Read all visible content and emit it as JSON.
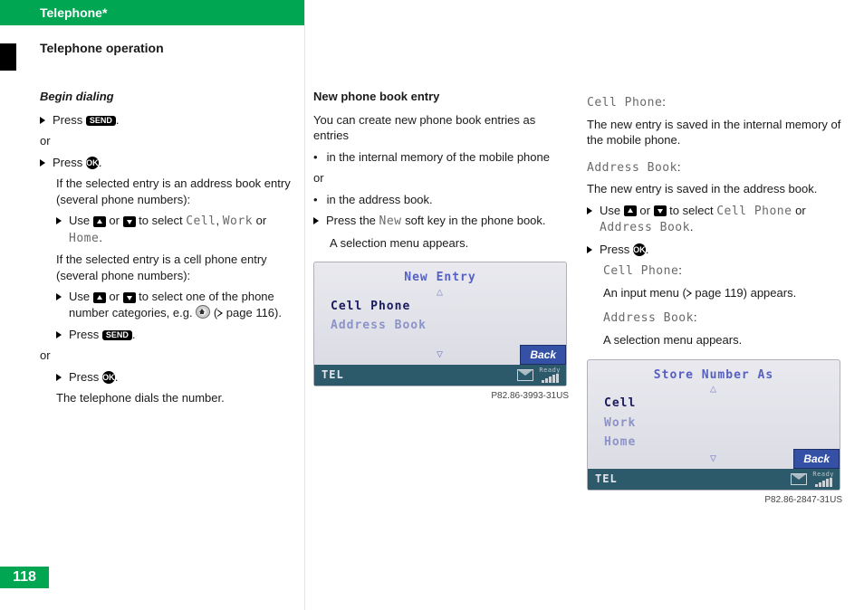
{
  "header": {
    "title": "Telephone*",
    "section": "Telephone operation"
  },
  "page_number": "118",
  "buttons": {
    "send": "SEND",
    "ok": "OK",
    "back": "Back"
  },
  "mono": {
    "cell": "Cell",
    "work": "Work",
    "home": "Home",
    "cell_phone": "Cell Phone",
    "address_book": "Address Book",
    "new": "New"
  },
  "col1": {
    "heading": "Begin dialing",
    "s1_a": "Press ",
    "s1_b": ".",
    "or": "or",
    "s2_a": "Press ",
    "s2_b": ".",
    "p1": "If the selected entry is an address book entry (several phone numbers):",
    "s3_a": "Use ",
    "s3_b": " or ",
    "s3_c": " to select ",
    "s3_d": ", ",
    "s3_e": " or ",
    "s3_f": ".",
    "p2": "If the selected entry is a cell phone entry (several phone numbers):",
    "s4_a": "Use ",
    "s4_b": " or ",
    "s4_c": " to select one of the phone number categories, e.g. ",
    "s4_d": " (",
    "s4_e": " page 116).",
    "s5_a": "Press ",
    "s5_b": ".",
    "s6_a": "Press ",
    "s6_b": ".",
    "p3": "The telephone dials the number."
  },
  "col2": {
    "heading": "New phone book entry",
    "p1": "You can create new phone book entries as entries",
    "b1": "in the internal memory of the mobile phone",
    "or": "or",
    "b2": "in the address book.",
    "s1_a": "Press the ",
    "s1_b": " soft key in the phone book.",
    "p2": "A selection menu appears.",
    "screen": {
      "title": "New Entry",
      "opt1": "Cell Phone",
      "opt2": "Address Book",
      "tel": "TEL",
      "caption": "P82.86-3993-31US"
    }
  },
  "col3": {
    "la": ":",
    "p1": "The new entry is saved in the internal memory of the mobile phone.",
    "lb": ":",
    "p2": "The new entry is saved in the address book.",
    "s1_a": "Use ",
    "s1_b": " or ",
    "s1_c": " to select ",
    "s1_d": " or ",
    "s1_e": ".",
    "s2_a": "Press ",
    "s2_b": ".",
    "lc": ":",
    "p3_a": "An input menu (",
    "p3_b": " page 119) appears.",
    "ld": ":",
    "p4": "A selection menu appears.",
    "screen": {
      "title": "Store Number As",
      "opt1": "Cell",
      "opt2": "Work",
      "opt3": "Home",
      "tel": "TEL",
      "caption": "P82.86-2847-31US"
    }
  }
}
